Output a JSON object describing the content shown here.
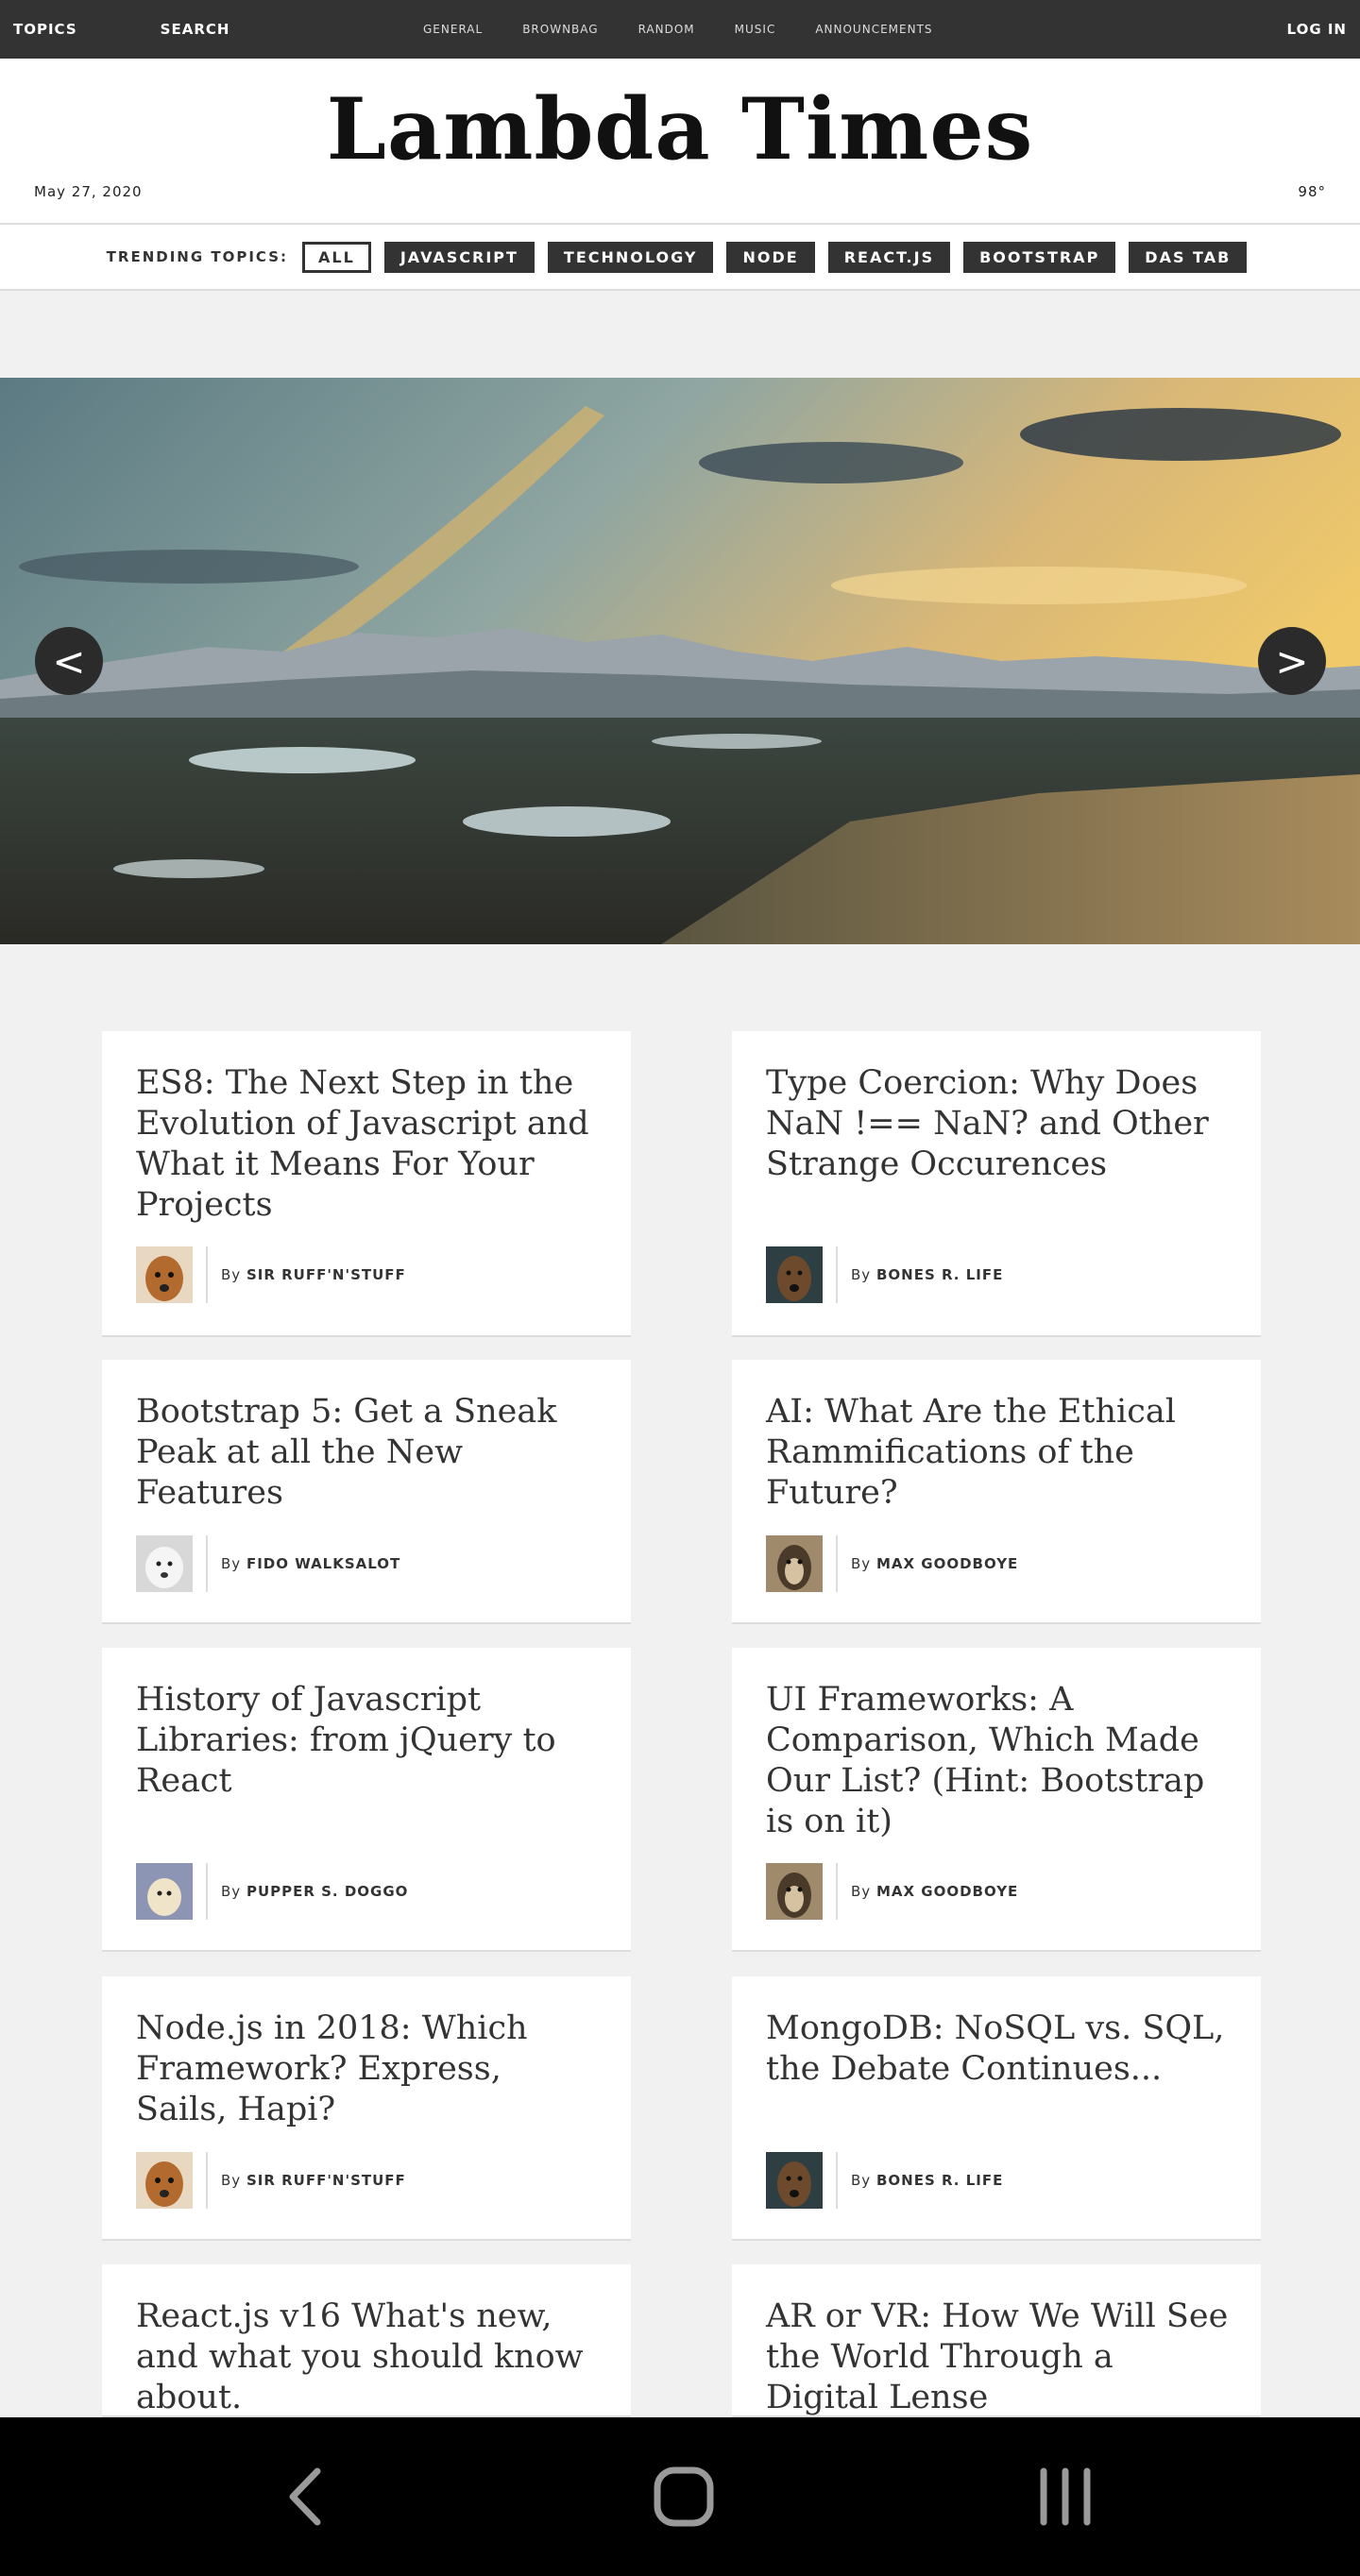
{
  "topbar": {
    "topics": "TOPICS",
    "search": "SEARCH",
    "links": [
      "GENERAL",
      "BROWNBAG",
      "RANDOM",
      "MUSIC",
      "ANNOUNCEMENTS"
    ],
    "login": "LOG IN"
  },
  "header": {
    "title": "Lambda Times",
    "date": "May 27, 2020",
    "temp": "98°"
  },
  "topics": {
    "title": "TRENDING TOPICS:",
    "tabs": [
      "ALL",
      "JAVASCRIPT",
      "TECHNOLOGY",
      "NODE",
      "REACT.JS",
      "BOOTSTRAP",
      "DAS TAB"
    ],
    "active": "ALL"
  },
  "carousel": {
    "prev": "<",
    "next": ">"
  },
  "cards": [
    {
      "headline": "ES8: The Next Step in the Evolution of Javascript and What it Means For Your Projects",
      "by": "By",
      "author": "SIR RUFF'N'STUFF",
      "avatar": "dog-orange"
    },
    {
      "headline": "Type Coercion: Why Does NaN !== NaN? and Other Strange Occurences",
      "by": "By",
      "author": "BONES R. LIFE",
      "avatar": "dog-dark"
    },
    {
      "headline": "Bootstrap 5: Get a Sneak Peak at all the New Features",
      "by": "By",
      "author": "FIDO WALKSALOT",
      "avatar": "dog-white"
    },
    {
      "headline": "AI: What Are the Ethical Rammifications of the Future?",
      "by": "By",
      "author": "MAX GOODBOYE",
      "avatar": "dog-brown"
    },
    {
      "headline": "History of Javascript Libraries: from jQuery to React",
      "by": "By",
      "author": "PUPPER S. DOGGO",
      "avatar": "dog-puppy"
    },
    {
      "headline": "UI Frameworks: A Comparison, Which Made Our List? (Hint: Bootstrap is on it)",
      "by": "By",
      "author": "MAX GOODBOYE",
      "avatar": "dog-brown"
    },
    {
      "headline": "Node.js in 2018: Which Framework? Express, Sails, Hapi?",
      "by": "By",
      "author": "SIR RUFF'N'STUFF",
      "avatar": "dog-orange"
    },
    {
      "headline": "MongoDB: NoSQL vs. SQL, the Debate Continues...",
      "by": "By",
      "author": "BONES R. LIFE",
      "avatar": "dog-dark"
    },
    {
      "headline": "React.js v16 What's new, and what you should know about."
    },
    {
      "headline": "AR or VR: How We Will See the World Through a Digital Lense"
    }
  ],
  "colors": {
    "topbar": "#333333",
    "page_bg": "#f1f1f1",
    "tab_bg": "#333333"
  }
}
